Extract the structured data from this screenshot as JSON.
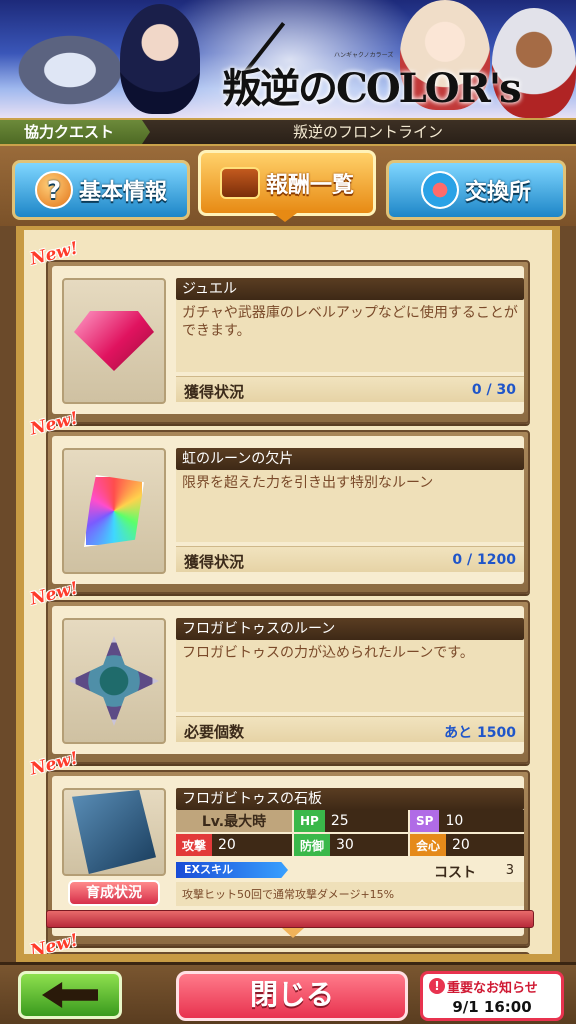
{
  "banner": {
    "logo_main": "叛逆のCOLOR's",
    "logo_sub": "ハンギャクノカラーズ"
  },
  "breadcrumb": {
    "section": "協力クエスト",
    "title": "叛逆のフロントライン"
  },
  "tabs": [
    {
      "label": "基本情報",
      "icon": "question-icon",
      "active": false
    },
    {
      "label": "報酬一覧",
      "icon": "treasure-chest-icon",
      "active": true
    },
    {
      "label": "交換所",
      "icon": "exchange-icon",
      "active": false
    }
  ],
  "items": [
    {
      "badge": "New!",
      "name": "ジュエル",
      "description": "ガチャや武器庫のレベルアップなどに使用することができます。",
      "status_label": "獲得状況",
      "status_value": "0 / 30",
      "icon": "jewel-icon"
    },
    {
      "badge": "New!",
      "name": "虹のルーンの欠片",
      "description": "限界を超えた力を引き出す特別なルーン",
      "status_label": "獲得状況",
      "status_value": "0 / 1200",
      "icon": "rainbow-rune-icon"
    },
    {
      "badge": "New!",
      "name": "フロガビトゥスのルーン",
      "description": "フロガビトゥスの力が込められたルーンです。",
      "status_label": "必要個数",
      "status_value": "あと 1500",
      "icon": "rune-emblem-icon"
    }
  ],
  "slate": {
    "badge": "New!",
    "name": "フロガビトゥスの石板",
    "grow_button": "育成状況",
    "lv_label": "Lv.最大時",
    "hp_label": "HP",
    "hp_value": "25",
    "sp_label": "SP",
    "sp_value": "10",
    "atk_label": "攻撃",
    "atk_value": "20",
    "def_label": "防御",
    "def_value": "30",
    "crit_label": "会心",
    "crit_value": "20",
    "ex_label": "EXスキル",
    "cost_label": "コスト",
    "cost_value": "3",
    "ex_description": "攻撃ヒット50回で通常攻撃ダメージ+15%",
    "icon": "stone-slate-icon"
  },
  "next_badge": "New!",
  "bottom": {
    "close_label": "閉じる",
    "notice_title": "重要なお知らせ",
    "notice_icon": "!",
    "notice_date": "9/1 16:00"
  },
  "colors": {
    "accent_orange": "#e78a14",
    "tab_blue": "#1e86c7",
    "value_blue": "#1f55c9",
    "new_red": "#ff3b2a",
    "close_pink": "#e8334f",
    "back_green": "#3a9a1e"
  }
}
